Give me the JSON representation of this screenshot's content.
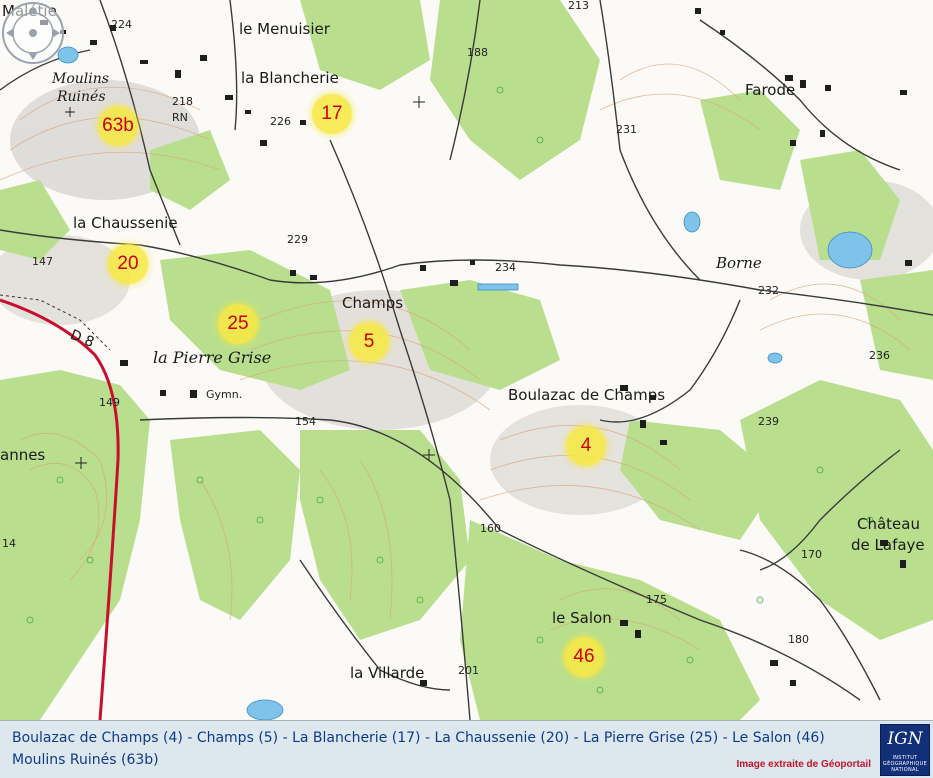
{
  "place_names": {
    "maletie": "Malétie",
    "le_menuisier": "le Menuisier",
    "la_blancherie": "la Blancherie",
    "moulins_ruines_1": "Moulins",
    "moulins_ruines_2": "Ruinés",
    "rn": "RN",
    "la_chaussenie": "la Chaussenie",
    "champs": "Champs",
    "la_pierre_grise": "la Pierre Grise",
    "gymn": "Gymn.",
    "boulazac_de_champs": "Boulazac de Champs",
    "farode": "Farode",
    "borne": "Borne",
    "chateau_1": "Château",
    "chateau_2": "de Lafaye",
    "annes": "annes",
    "le_salon": "le Salon",
    "la_villarde": "la Villarde",
    "d8": "D 8"
  },
  "altitudes": [
    "224",
    "218",
    "226",
    "188",
    "231",
    "229",
    "234",
    "232",
    "147",
    "236",
    "149",
    "154",
    "239",
    "160",
    "170",
    "175",
    "180",
    "201",
    "14",
    "213"
  ],
  "markers": [
    "63b",
    "17",
    "20",
    "25",
    "5",
    "4",
    "46"
  ],
  "legend": {
    "line1": "Boulazac de Champs (4) - Champs (5) - La Blancherie (17) - La Chaussenie (20) - La Pierre Grise (25) - Le Salon (46)",
    "line2": "Moulins Ruinés (63b)",
    "credit": "Image extraite de Géoportail"
  },
  "ign_logo": {
    "text": "IGN",
    "subtitle": "INSTITUT GÉOGRAPHIQUE NATIONAL"
  },
  "colors": {
    "marker_fill": "#f6e844",
    "marker_text": "#d10000",
    "forest": "#b9df8e",
    "road_d8": "#c8102e",
    "legend_text": "#103a8a",
    "credit_text": "#c0152a",
    "footer_bg": "#dde7ee"
  },
  "icons": [
    "compass-icon",
    "ign-logo-icon"
  ]
}
